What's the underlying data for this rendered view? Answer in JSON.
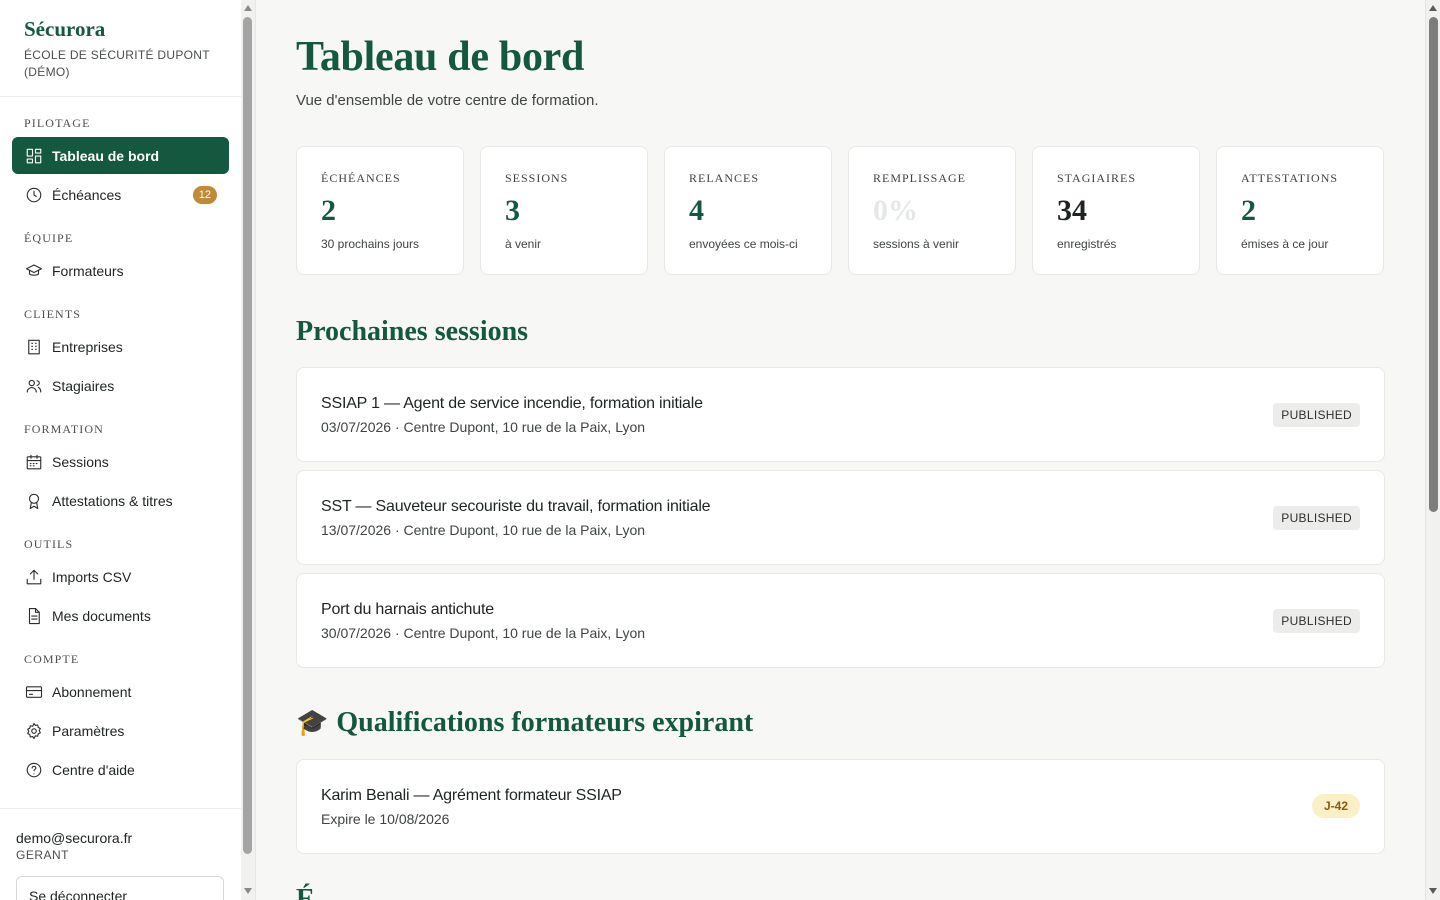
{
  "brand": {
    "name": "Sécurora",
    "subtitle": "ÉCOLE DE SÉCURITÉ DUPONT (DÉMO)"
  },
  "sidebar": {
    "sections": [
      {
        "label": "PILOTAGE",
        "items": [
          {
            "label": "Tableau de bord",
            "icon": "dashboard-icon",
            "active": true
          },
          {
            "label": "Échéances",
            "icon": "clock-icon",
            "badge": "12"
          }
        ]
      },
      {
        "label": "ÉQUIPE",
        "items": [
          {
            "label": "Formateurs",
            "icon": "graduation-cap-icon"
          }
        ]
      },
      {
        "label": "CLIENTS",
        "items": [
          {
            "label": "Entreprises",
            "icon": "building-icon"
          },
          {
            "label": "Stagiaires",
            "icon": "users-icon"
          }
        ]
      },
      {
        "label": "FORMATION",
        "items": [
          {
            "label": "Sessions",
            "icon": "calendar-icon"
          },
          {
            "label": "Attestations & titres",
            "icon": "award-icon"
          }
        ]
      },
      {
        "label": "OUTILS",
        "items": [
          {
            "label": "Imports CSV",
            "icon": "upload-icon"
          },
          {
            "label": "Mes documents",
            "icon": "document-icon"
          }
        ]
      },
      {
        "label": "COMPTE",
        "items": [
          {
            "label": "Abonnement",
            "icon": "credit-card-icon"
          },
          {
            "label": "Paramètres",
            "icon": "gear-icon"
          },
          {
            "label": "Centre d'aide",
            "icon": "help-circle-icon"
          }
        ]
      }
    ],
    "user": {
      "email": "demo@securora.fr",
      "role": "GERANT",
      "logout_label": "Se déconnecter"
    }
  },
  "main": {
    "title": "Tableau de bord",
    "subtitle": "Vue d'ensemble de votre centre de formation.",
    "stats": [
      {
        "label": "ÉCHÉANCES",
        "value": "2",
        "hint": "30 prochains jours",
        "tone": "green"
      },
      {
        "label": "SESSIONS",
        "value": "3",
        "hint": "à venir",
        "tone": "green"
      },
      {
        "label": "RELANCES",
        "value": "4",
        "hint": "envoyées ce mois-ci",
        "tone": "green"
      },
      {
        "label": "REMPLISSAGE",
        "value": "0%",
        "hint": "sessions à venir",
        "tone": "muted"
      },
      {
        "label": "STAGIAIRES",
        "value": "34",
        "hint": "enregistrés",
        "tone": "dark"
      },
      {
        "label": "ATTESTATIONS",
        "value": "2",
        "hint": "émises à ce jour",
        "tone": "green"
      }
    ],
    "sessions_title": "Prochaines sessions",
    "sessions": [
      {
        "title": "SSIAP 1 — Agent de service incendie, formation initiale",
        "details": "03/07/2026 · Centre Dupont, 10 rue de la Paix, Lyon",
        "status": "PUBLISHED"
      },
      {
        "title": "SST — Sauveteur secouriste du travail, formation initiale",
        "details": "13/07/2026 · Centre Dupont, 10 rue de la Paix, Lyon",
        "status": "PUBLISHED"
      },
      {
        "title": "Port du harnais antichute",
        "details": "30/07/2026 · Centre Dupont, 10 rue de la Paix, Lyon",
        "status": "PUBLISHED"
      }
    ],
    "qualifications_emoji": "🎓",
    "qualifications_title": "Qualifications formateurs expirant",
    "qualifications": [
      {
        "title": "Karim Benali — Agrément formateur SSIAP",
        "details": "Expire le 10/08/2026",
        "countdown": "J-42"
      }
    ],
    "next_section_partial": "É"
  },
  "colors": {
    "brand_green": "#14583f",
    "badge_gold": "#c08a38",
    "pill_bg": "#fbefc6"
  }
}
